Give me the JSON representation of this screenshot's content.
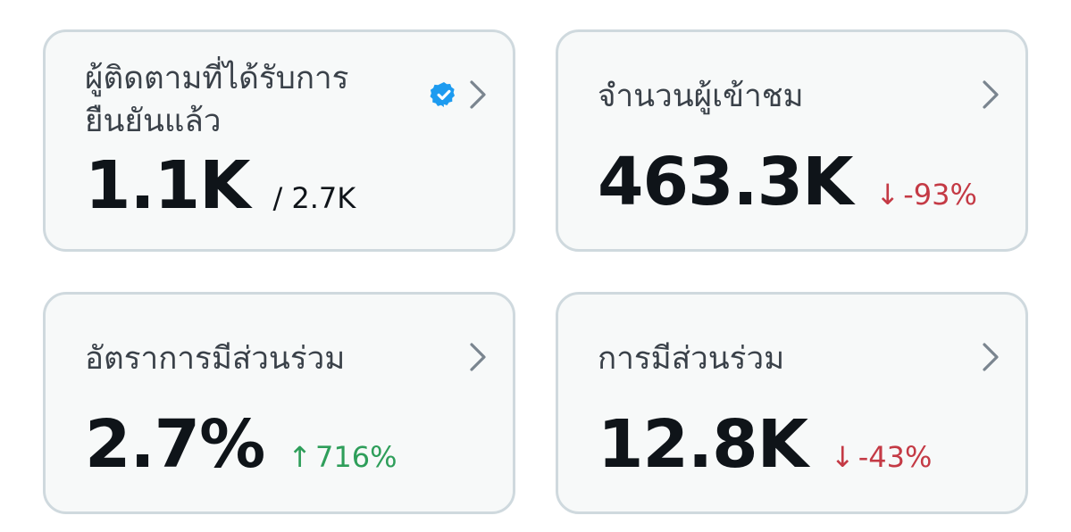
{
  "cards": [
    {
      "title_line1": "ผู้ติดตามที่ได้รับการ",
      "title_line2": "ยืนยันแล้ว",
      "value": "1.1K",
      "secondary": "/ 2.7K",
      "icon": "verified-badge-icon",
      "accent": "#1d9bf0"
    },
    {
      "title": "จำนวนผู้เข้าชม",
      "value": "463.3K",
      "change_arrow": "↓",
      "change": "-93%",
      "change_color": "#c43a45"
    },
    {
      "title": "อัตราการมีส่วนร่วม",
      "value": "2.7%",
      "change_arrow": "↑",
      "change": "716%",
      "change_color": "#2e9e5a"
    },
    {
      "title": "การมีส่วนร่วม",
      "value": "12.8K",
      "change_arrow": "↓",
      "change": "-43%",
      "change_color": "#c43a45"
    }
  ]
}
